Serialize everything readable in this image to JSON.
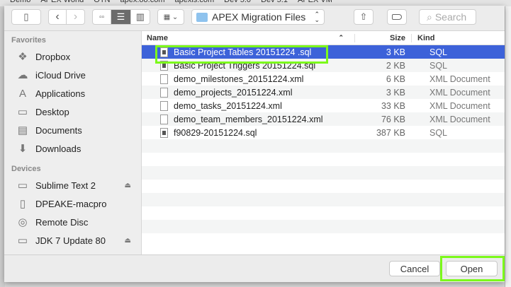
{
  "background": {
    "bookmarks": [
      "Demo",
      "APEX World",
      "OTN",
      "apex.oo.com",
      "apexis.com",
      "Dev 5.0",
      "Dev 5.1",
      "APEX VM"
    ]
  },
  "toolbar": {
    "location": "APEX Migration Files",
    "search_placeholder": "Search"
  },
  "sidebar": {
    "favorites_label": "Favorites",
    "favorites": [
      {
        "label": "Dropbox",
        "icon": "dropbox-icon"
      },
      {
        "label": "iCloud Drive",
        "icon": "cloud-icon"
      },
      {
        "label": "Applications",
        "icon": "applications-icon"
      },
      {
        "label": "Desktop",
        "icon": "desktop-icon"
      },
      {
        "label": "Documents",
        "icon": "documents-icon"
      },
      {
        "label": "Downloads",
        "icon": "downloads-icon"
      }
    ],
    "devices_label": "Devices",
    "devices": [
      {
        "label": "Sublime Text 2",
        "eject": true
      },
      {
        "label": "DPEAKE-macpro",
        "eject": false
      },
      {
        "label": "Remote Disc",
        "eject": false
      },
      {
        "label": "JDK 7 Update 80",
        "eject": true
      }
    ]
  },
  "list": {
    "columns": {
      "name": "Name",
      "size": "Size",
      "kind": "Kind"
    },
    "files": [
      {
        "name": "Basic Project Tables 20151224 .sql",
        "size": "3 KB",
        "kind": "SQL",
        "type": "sql",
        "selected": true
      },
      {
        "name": "Basic Project Triggers 20151224.sql",
        "size": "2 KB",
        "kind": "SQL",
        "type": "sql"
      },
      {
        "name": "demo_milestones_20151224.xml",
        "size": "6 KB",
        "kind": "XML Document",
        "type": "xml"
      },
      {
        "name": "demo_projects_20151224.xml",
        "size": "3 KB",
        "kind": "XML Document",
        "type": "xml"
      },
      {
        "name": "demo_tasks_20151224.xml",
        "size": "33 KB",
        "kind": "XML Document",
        "type": "xml"
      },
      {
        "name": "demo_team_members_20151224.xml",
        "size": "76 KB",
        "kind": "XML Document",
        "type": "xml"
      },
      {
        "name": "f90829-20151224.sql",
        "size": "387 KB",
        "kind": "SQL",
        "type": "sql"
      }
    ]
  },
  "footer": {
    "cancel": "Cancel",
    "open": "Open"
  },
  "colors": {
    "selection": "#3d62d9",
    "highlight": "#7cf91b"
  }
}
